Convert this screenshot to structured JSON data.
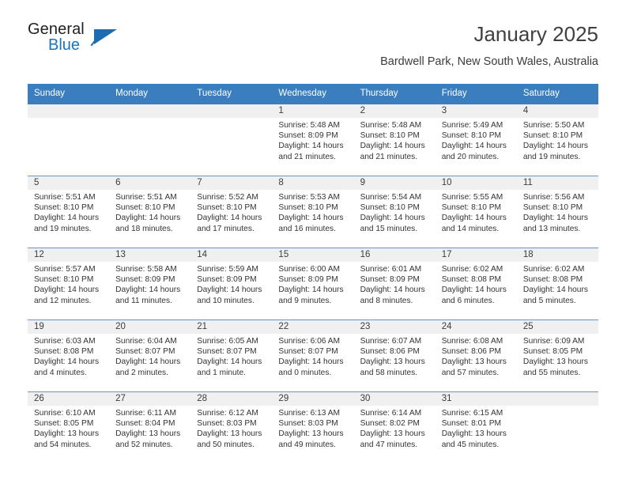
{
  "brand": {
    "name_part1": "General",
    "name_part2": "Blue",
    "accent_color": "#1b6cb0"
  },
  "header": {
    "title": "January 2025",
    "subtitle": "Bardwell Park, New South Wales, Australia"
  },
  "calendar": {
    "header_bg": "#3a7ebf",
    "daynum_bg": "#f0f0f0",
    "row_border": "#6f93ba",
    "weekday_headers": [
      "Sunday",
      "Monday",
      "Tuesday",
      "Wednesday",
      "Thursday",
      "Friday",
      "Saturday"
    ],
    "weeks": [
      [
        {
          "day": ""
        },
        {
          "day": ""
        },
        {
          "day": ""
        },
        {
          "day": "1",
          "sunrise": "Sunrise: 5:48 AM",
          "sunset": "Sunset: 8:09 PM",
          "daylight1": "Daylight: 14 hours",
          "daylight2": "and 21 minutes."
        },
        {
          "day": "2",
          "sunrise": "Sunrise: 5:48 AM",
          "sunset": "Sunset: 8:10 PM",
          "daylight1": "Daylight: 14 hours",
          "daylight2": "and 21 minutes."
        },
        {
          "day": "3",
          "sunrise": "Sunrise: 5:49 AM",
          "sunset": "Sunset: 8:10 PM",
          "daylight1": "Daylight: 14 hours",
          "daylight2": "and 20 minutes."
        },
        {
          "day": "4",
          "sunrise": "Sunrise: 5:50 AM",
          "sunset": "Sunset: 8:10 PM",
          "daylight1": "Daylight: 14 hours",
          "daylight2": "and 19 minutes."
        }
      ],
      [
        {
          "day": "5",
          "sunrise": "Sunrise: 5:51 AM",
          "sunset": "Sunset: 8:10 PM",
          "daylight1": "Daylight: 14 hours",
          "daylight2": "and 19 minutes."
        },
        {
          "day": "6",
          "sunrise": "Sunrise: 5:51 AM",
          "sunset": "Sunset: 8:10 PM",
          "daylight1": "Daylight: 14 hours",
          "daylight2": "and 18 minutes."
        },
        {
          "day": "7",
          "sunrise": "Sunrise: 5:52 AM",
          "sunset": "Sunset: 8:10 PM",
          "daylight1": "Daylight: 14 hours",
          "daylight2": "and 17 minutes."
        },
        {
          "day": "8",
          "sunrise": "Sunrise: 5:53 AM",
          "sunset": "Sunset: 8:10 PM",
          "daylight1": "Daylight: 14 hours",
          "daylight2": "and 16 minutes."
        },
        {
          "day": "9",
          "sunrise": "Sunrise: 5:54 AM",
          "sunset": "Sunset: 8:10 PM",
          "daylight1": "Daylight: 14 hours",
          "daylight2": "and 15 minutes."
        },
        {
          "day": "10",
          "sunrise": "Sunrise: 5:55 AM",
          "sunset": "Sunset: 8:10 PM",
          "daylight1": "Daylight: 14 hours",
          "daylight2": "and 14 minutes."
        },
        {
          "day": "11",
          "sunrise": "Sunrise: 5:56 AM",
          "sunset": "Sunset: 8:10 PM",
          "daylight1": "Daylight: 14 hours",
          "daylight2": "and 13 minutes."
        }
      ],
      [
        {
          "day": "12",
          "sunrise": "Sunrise: 5:57 AM",
          "sunset": "Sunset: 8:10 PM",
          "daylight1": "Daylight: 14 hours",
          "daylight2": "and 12 minutes."
        },
        {
          "day": "13",
          "sunrise": "Sunrise: 5:58 AM",
          "sunset": "Sunset: 8:09 PM",
          "daylight1": "Daylight: 14 hours",
          "daylight2": "and 11 minutes."
        },
        {
          "day": "14",
          "sunrise": "Sunrise: 5:59 AM",
          "sunset": "Sunset: 8:09 PM",
          "daylight1": "Daylight: 14 hours",
          "daylight2": "and 10 minutes."
        },
        {
          "day": "15",
          "sunrise": "Sunrise: 6:00 AM",
          "sunset": "Sunset: 8:09 PM",
          "daylight1": "Daylight: 14 hours",
          "daylight2": "and 9 minutes."
        },
        {
          "day": "16",
          "sunrise": "Sunrise: 6:01 AM",
          "sunset": "Sunset: 8:09 PM",
          "daylight1": "Daylight: 14 hours",
          "daylight2": "and 8 minutes."
        },
        {
          "day": "17",
          "sunrise": "Sunrise: 6:02 AM",
          "sunset": "Sunset: 8:08 PM",
          "daylight1": "Daylight: 14 hours",
          "daylight2": "and 6 minutes."
        },
        {
          "day": "18",
          "sunrise": "Sunrise: 6:02 AM",
          "sunset": "Sunset: 8:08 PM",
          "daylight1": "Daylight: 14 hours",
          "daylight2": "and 5 minutes."
        }
      ],
      [
        {
          "day": "19",
          "sunrise": "Sunrise: 6:03 AM",
          "sunset": "Sunset: 8:08 PM",
          "daylight1": "Daylight: 14 hours",
          "daylight2": "and 4 minutes."
        },
        {
          "day": "20",
          "sunrise": "Sunrise: 6:04 AM",
          "sunset": "Sunset: 8:07 PM",
          "daylight1": "Daylight: 14 hours",
          "daylight2": "and 2 minutes."
        },
        {
          "day": "21",
          "sunrise": "Sunrise: 6:05 AM",
          "sunset": "Sunset: 8:07 PM",
          "daylight1": "Daylight: 14 hours",
          "daylight2": "and 1 minute."
        },
        {
          "day": "22",
          "sunrise": "Sunrise: 6:06 AM",
          "sunset": "Sunset: 8:07 PM",
          "daylight1": "Daylight: 14 hours",
          "daylight2": "and 0 minutes."
        },
        {
          "day": "23",
          "sunrise": "Sunrise: 6:07 AM",
          "sunset": "Sunset: 8:06 PM",
          "daylight1": "Daylight: 13 hours",
          "daylight2": "and 58 minutes."
        },
        {
          "day": "24",
          "sunrise": "Sunrise: 6:08 AM",
          "sunset": "Sunset: 8:06 PM",
          "daylight1": "Daylight: 13 hours",
          "daylight2": "and 57 minutes."
        },
        {
          "day": "25",
          "sunrise": "Sunrise: 6:09 AM",
          "sunset": "Sunset: 8:05 PM",
          "daylight1": "Daylight: 13 hours",
          "daylight2": "and 55 minutes."
        }
      ],
      [
        {
          "day": "26",
          "sunrise": "Sunrise: 6:10 AM",
          "sunset": "Sunset: 8:05 PM",
          "daylight1": "Daylight: 13 hours",
          "daylight2": "and 54 minutes."
        },
        {
          "day": "27",
          "sunrise": "Sunrise: 6:11 AM",
          "sunset": "Sunset: 8:04 PM",
          "daylight1": "Daylight: 13 hours",
          "daylight2": "and 52 minutes."
        },
        {
          "day": "28",
          "sunrise": "Sunrise: 6:12 AM",
          "sunset": "Sunset: 8:03 PM",
          "daylight1": "Daylight: 13 hours",
          "daylight2": "and 50 minutes."
        },
        {
          "day": "29",
          "sunrise": "Sunrise: 6:13 AM",
          "sunset": "Sunset: 8:03 PM",
          "daylight1": "Daylight: 13 hours",
          "daylight2": "and 49 minutes."
        },
        {
          "day": "30",
          "sunrise": "Sunrise: 6:14 AM",
          "sunset": "Sunset: 8:02 PM",
          "daylight1": "Daylight: 13 hours",
          "daylight2": "and 47 minutes."
        },
        {
          "day": "31",
          "sunrise": "Sunrise: 6:15 AM",
          "sunset": "Sunset: 8:01 PM",
          "daylight1": "Daylight: 13 hours",
          "daylight2": "and 45 minutes."
        },
        {
          "day": ""
        }
      ]
    ]
  }
}
